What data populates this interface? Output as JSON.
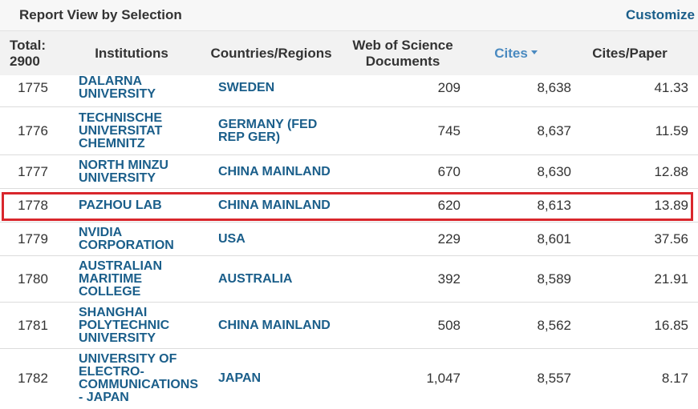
{
  "toolbar": {
    "title": "Report View by Selection",
    "customize": "Customize"
  },
  "columns": {
    "total": "Total:\n2900",
    "institutions": "Institutions",
    "countries": "Countries/Regions",
    "wos_documents": "Web of Science Documents",
    "cites": "Cites",
    "cites_per_paper": "Cites/Paper"
  },
  "rows": [
    {
      "rank": "1775",
      "institution": "DALARNA UNIVERSITY",
      "country": "SWEDEN",
      "docs": "209",
      "cites": "8,638",
      "cpp": "41.33"
    },
    {
      "rank": "1776",
      "institution": "TECHNISCHE UNIVERSITAT CHEMNITZ",
      "country": "GERMANY (FED REP GER)",
      "docs": "745",
      "cites": "8,637",
      "cpp": "11.59"
    },
    {
      "rank": "1777",
      "institution": "NORTH MINZU UNIVERSITY",
      "country": "CHINA MAINLAND",
      "docs": "670",
      "cites": "8,630",
      "cpp": "12.88"
    },
    {
      "rank": "1778",
      "institution": "PAZHOU LAB",
      "country": "CHINA MAINLAND",
      "docs": "620",
      "cites": "8,613",
      "cpp": "13.89"
    },
    {
      "rank": "1779",
      "institution": "NVIDIA CORPORATION",
      "country": "USA",
      "docs": "229",
      "cites": "8,601",
      "cpp": "37.56"
    },
    {
      "rank": "1780",
      "institution": "AUSTRALIAN MARITIME COLLEGE",
      "country": "AUSTRALIA",
      "docs": "392",
      "cites": "8,589",
      "cpp": "21.91"
    },
    {
      "rank": "1781",
      "institution": "SHANGHAI POLYTECHNIC UNIVERSITY",
      "country": "CHINA MAINLAND",
      "docs": "508",
      "cites": "8,562",
      "cpp": "16.85"
    },
    {
      "rank": "1782",
      "institution": "UNIVERSITY OF ELECTRO-COMMUNICATIONS - JAPAN",
      "country": "JAPAN",
      "docs": "1,047",
      "cites": "8,557",
      "cpp": "8.17"
    }
  ],
  "colors": {
    "link": "#1a5e8a",
    "sorted_header": "#4a8ac0",
    "highlight": "#d9262c"
  }
}
